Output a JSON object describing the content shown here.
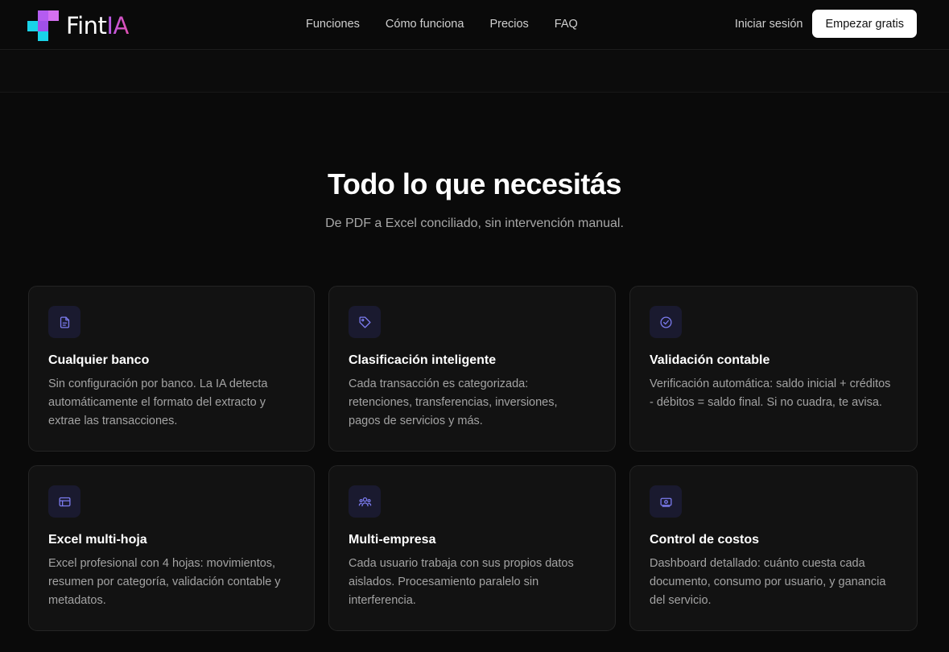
{
  "brand": {
    "name_prefix": "Fint",
    "name_suffix": "IA"
  },
  "nav": {
    "items": [
      {
        "label": "Funciones"
      },
      {
        "label": "Cómo funciona"
      },
      {
        "label": "Precios"
      },
      {
        "label": "FAQ"
      }
    ],
    "login_label": "Iniciar sesión",
    "cta_label": "Empezar gratis"
  },
  "hero": {
    "title": "Todo lo que necesitás",
    "subtitle": "De PDF a Excel conciliado, sin intervención manual."
  },
  "features": [
    {
      "icon": "document-icon",
      "title": "Cualquier banco",
      "description": "Sin configuración por banco. La IA detecta automáticamente el formato del extracto y extrae las transacciones."
    },
    {
      "icon": "tag-icon",
      "title": "Clasificación inteligente",
      "description": "Cada transacción es categorizada: retenciones, transferencias, inversiones, pagos de servicios y más."
    },
    {
      "icon": "check-circle-icon",
      "title": "Validación contable",
      "description": "Verificación automática: saldo inicial + créditos - débitos = saldo final. Si no cuadra, te avisa."
    },
    {
      "icon": "spreadsheet-icon",
      "title": "Excel multi-hoja",
      "description": "Excel profesional con 4 hojas: movimientos, resumen por categoría, validación contable y metadatos."
    },
    {
      "icon": "users-icon",
      "title": "Multi-empresa",
      "description": "Cada usuario trabaja con sus propios datos aislados. Procesamiento paralelo sin interferencia."
    },
    {
      "icon": "money-icon",
      "title": "Control de costos",
      "description": "Dashboard detallado: cuánto cuesta cada documento, consumo por usuario, y ganancia del servicio."
    }
  ],
  "colors": {
    "background": "#0a0a0a",
    "card": "#121212",
    "icon_accent": "#7c7cf0",
    "logo_cyan": "#19d3e8",
    "logo_purple": "#b45cf0"
  }
}
